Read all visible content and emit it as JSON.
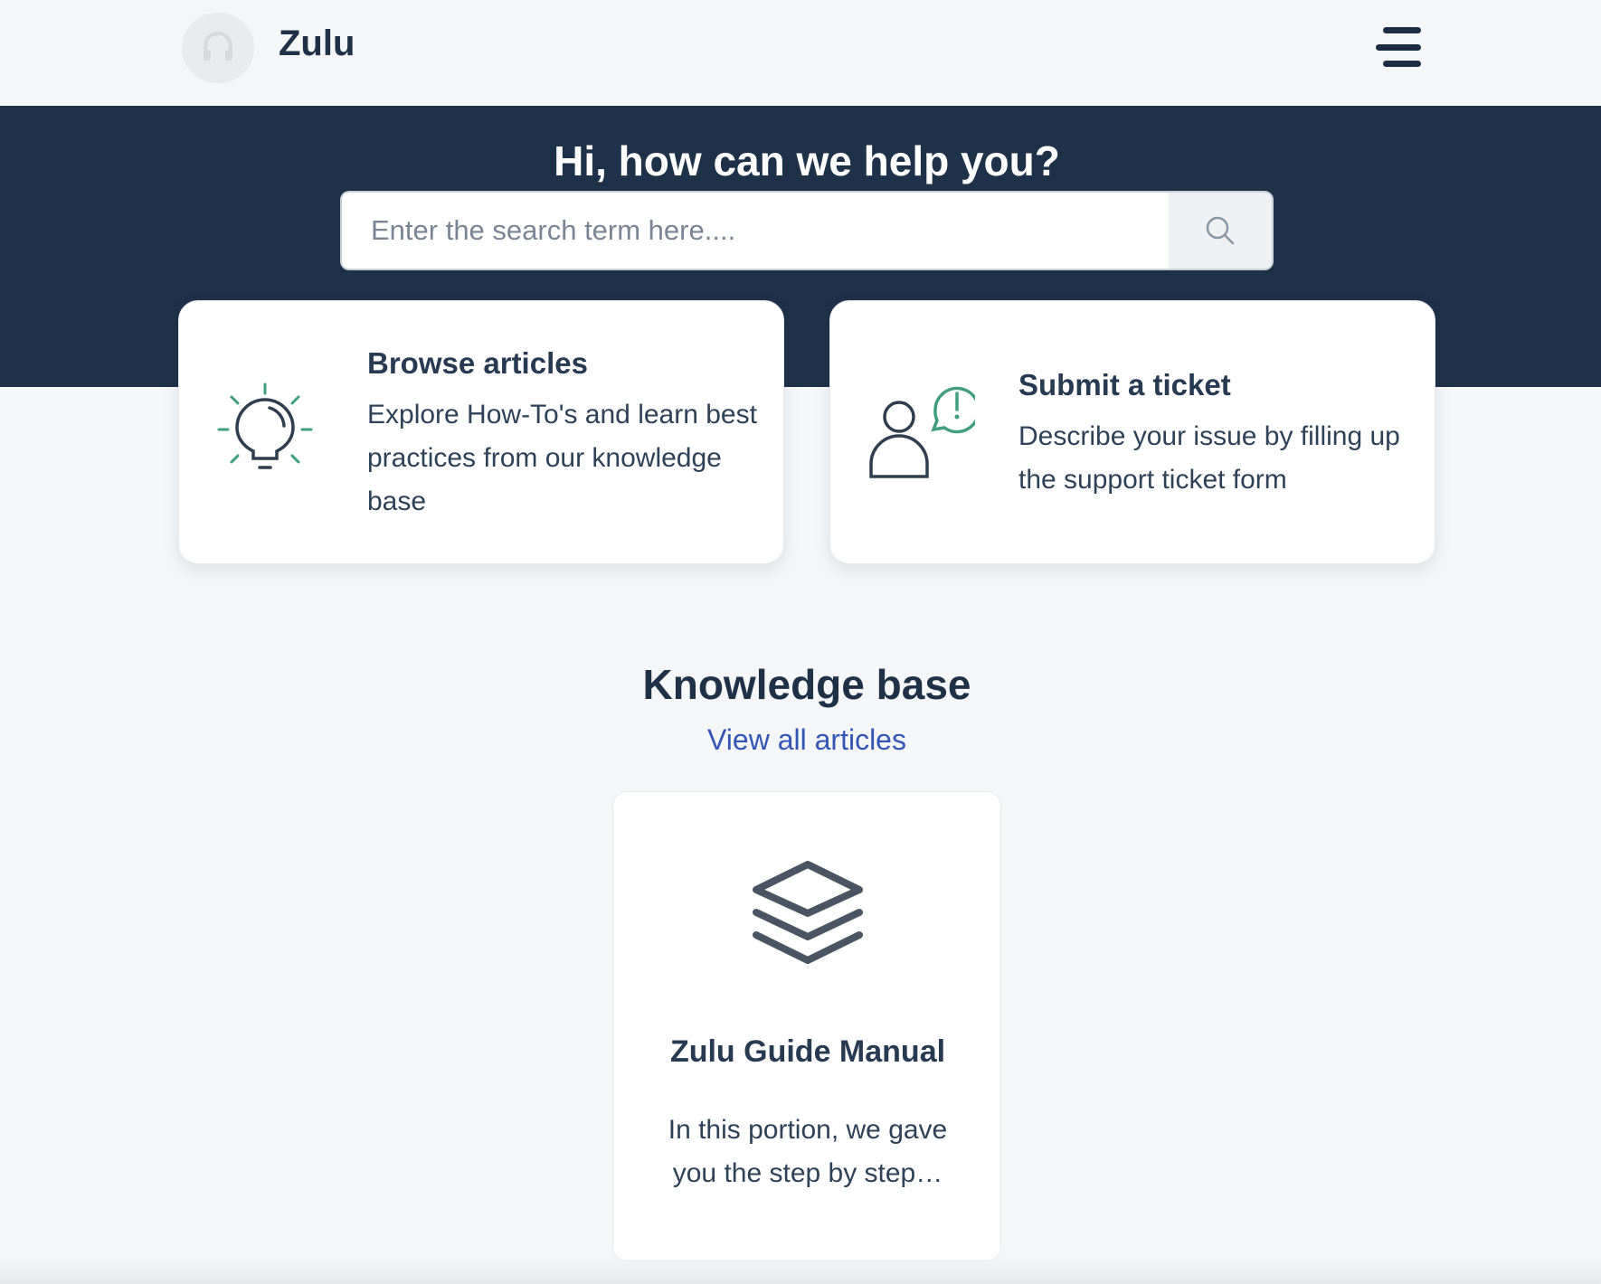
{
  "header": {
    "brand": "Zulu",
    "logo_icon": "headset-icon",
    "menu_icon": "hamburger-menu-icon"
  },
  "hero": {
    "title": "Hi, how can we help you?",
    "search": {
      "placeholder": "Enter the search term here....",
      "value": "",
      "button_icon": "search-icon"
    }
  },
  "cards": [
    {
      "icon": "lightbulb-icon",
      "title": "Browse articles",
      "description": "Explore How-To's and learn best practices from our knowledge base"
    },
    {
      "icon": "person-alert-icon",
      "title": "Submit a ticket",
      "description": "Describe your issue by filling up the support ticket form"
    }
  ],
  "knowledge_base": {
    "title": "Knowledge base",
    "view_all": "View all articles",
    "categories": [
      {
        "icon": "layers-icon",
        "title": "Zulu Guide Manual",
        "description": "In this portion, we gave you the step by step…"
      }
    ]
  },
  "colors": {
    "hero_bg": "#1d3249",
    "page_bg": "#f4f6f8",
    "text": "#263a52",
    "link": "#3356b6",
    "accent_green": "#3f9e7c"
  }
}
